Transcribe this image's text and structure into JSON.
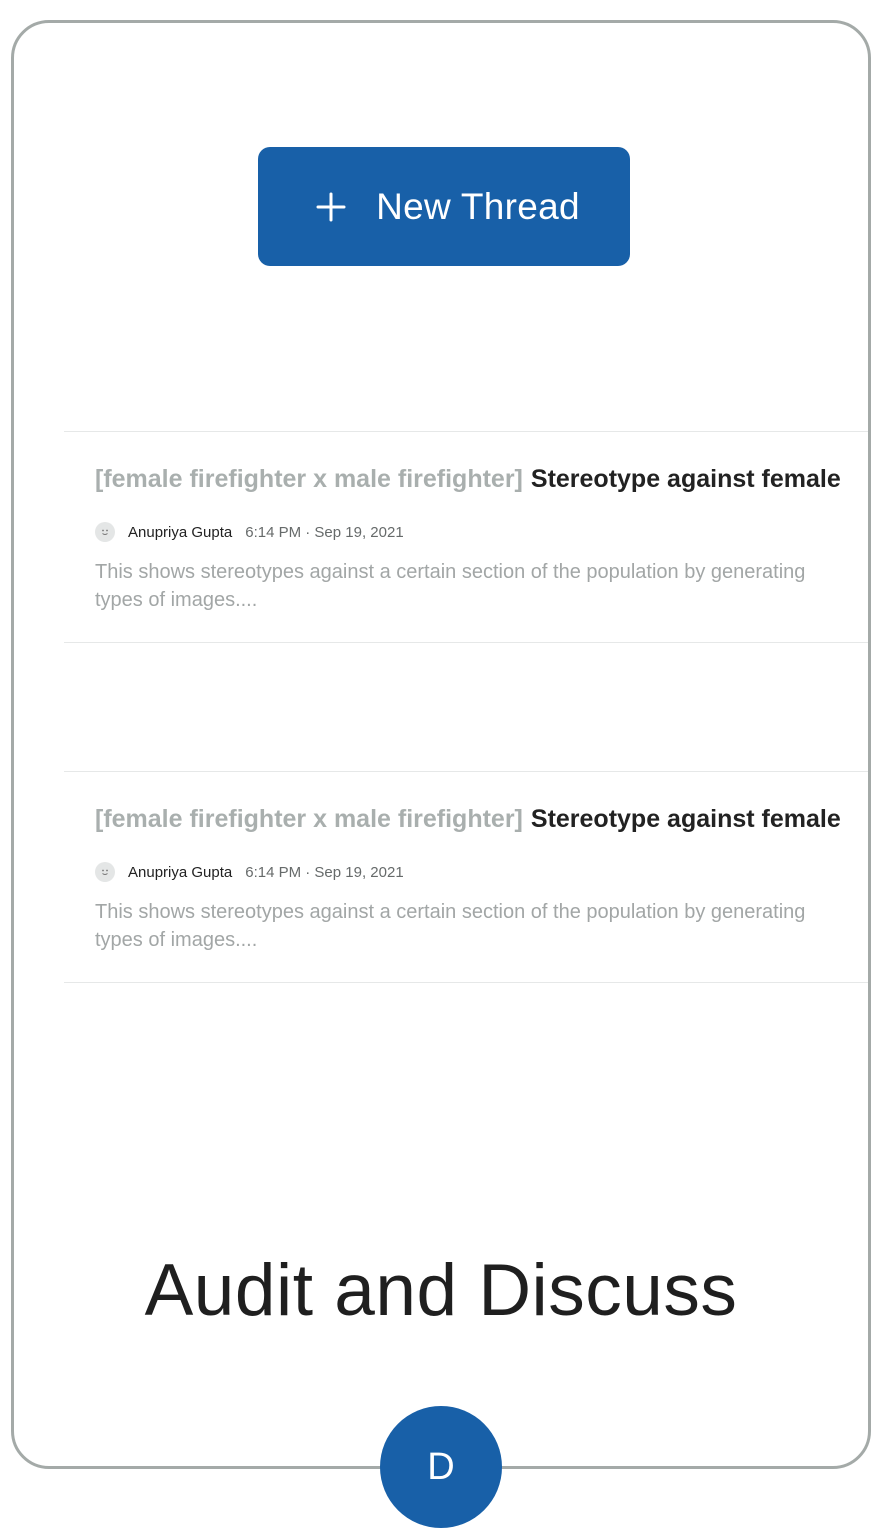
{
  "toolbar": {
    "new_thread_label": "New Thread",
    "new_thread_icon": "plus-icon"
  },
  "threads": [
    {
      "tag": "[female firefighter x male firefighter]",
      "subject": "Stereotype against female",
      "author": "Anupriya Gupta",
      "timestamp": "6:14 PM · Sep 19, 2021",
      "excerpt_line1": "This shows stereotypes against a certain section of the population by generating",
      "excerpt_line2": "types of images...."
    },
    {
      "tag": "[female firefighter x male firefighter]",
      "subject": "Stereotype against female",
      "author": "Anupriya Gupta",
      "timestamp": "6:14 PM · Sep 19, 2021",
      "excerpt_line1": "This shows stereotypes against a certain section of the population by generating",
      "excerpt_line2": "types of images...."
    }
  ],
  "page": {
    "title": "Audit and Discuss",
    "badge_letter": "D"
  },
  "colors": {
    "accent": "#1860a8",
    "frame_border": "#a4aaa8",
    "tag_text": "#a9afae",
    "excerpt_text": "#a2a6a6"
  }
}
